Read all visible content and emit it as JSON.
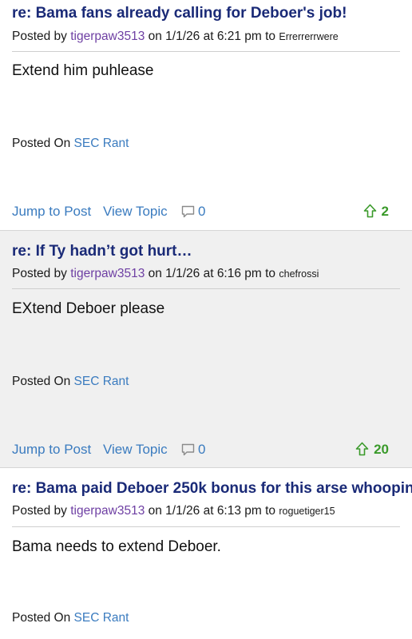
{
  "posts": [
    {
      "title": "re: Bama fans already calling for Deboer's job!",
      "meta_prefix": "Posted by ",
      "author": "tigerpaw3513",
      "meta_middle": " on 1/1/26 at 6:21 pm to ",
      "reply_to": "Errerrerrwere",
      "body": "Extend him puhlease",
      "posted_on_label": "Posted On ",
      "board": "SEC Rant",
      "jump_label": "Jump to Post",
      "view_label": "View Topic",
      "comment_count": "0",
      "upvotes": "2",
      "icons": {
        "comment": "comment-bubble-icon",
        "upvote": "upvote-arrow-icon"
      }
    },
    {
      "title": "re: If Ty hadn’t got hurt…",
      "meta_prefix": "Posted by ",
      "author": "tigerpaw3513",
      "meta_middle": " on 1/1/26 at 6:16 pm to ",
      "reply_to": "chefrossi",
      "body": "EXtend Deboer please",
      "posted_on_label": "Posted On ",
      "board": "SEC Rant",
      "jump_label": "Jump to Post",
      "view_label": "View Topic",
      "comment_count": "0",
      "upvotes": "20",
      "icons": {
        "comment": "comment-bubble-icon",
        "upvote": "upvote-arrow-icon"
      }
    },
    {
      "title": "re: Bama paid Deboer 250k bonus for this arse whoopin",
      "meta_prefix": "Posted by ",
      "author": "tigerpaw3513",
      "meta_middle": " on 1/1/26 at 6:13 pm to ",
      "reply_to": "roguetiger15",
      "body": "Bama needs to extend Deboer.",
      "posted_on_label": "Posted On ",
      "board": "SEC Rant"
    }
  ],
  "colors": {
    "title": "#1a2a77",
    "author": "#6e3fa3",
    "link": "#3a7bbf",
    "upvote": "#3a9a2a",
    "alt_background": "#f0f0f0"
  }
}
